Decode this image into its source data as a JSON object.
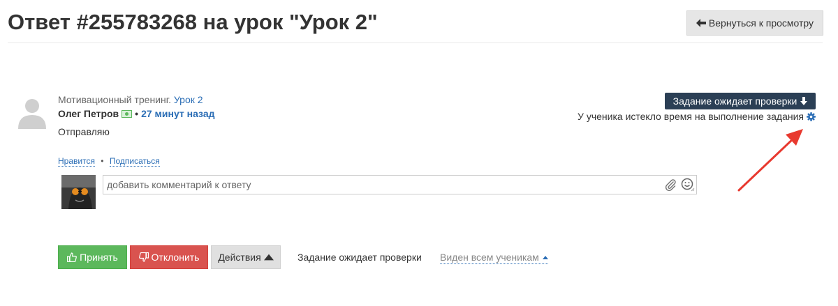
{
  "header": {
    "title": "Ответ #255783268 на урок \"Урок 2\"",
    "back_button_label": "Вернуться к просмотру"
  },
  "answer": {
    "training_prefix": "Мотивационный тренинг.",
    "lesson_link": "Урок 2",
    "author_name": "Олег Петров",
    "separator": "•",
    "time_ago": "27 минут назад",
    "text": "Отправляю",
    "status_badge": "Задание ожидает проверки",
    "expired_notice": "У ученика истекло время на выполнение задания"
  },
  "social": {
    "like_label": "Нравится",
    "separator": "•",
    "subscribe_label": "Подписаться"
  },
  "comment": {
    "placeholder": "добавить комментарий к ответу"
  },
  "toolbar": {
    "accept_label": "Принять",
    "reject_label": "Отклонить",
    "actions_label": "Действия",
    "status_text": "Задание ожидает проверки",
    "visibility_label": "Виден всем ученикам"
  },
  "colors": {
    "accent_blue": "#2a6db5",
    "accept_green": "#5cb85c",
    "reject_red": "#d9534f",
    "badge_dark": "#2b3f55",
    "annotation_arrow": "#e8392f"
  },
  "icons": {
    "back": "arrow-left-icon",
    "badge": "arrow-down-icon",
    "settings": "gear-icon",
    "money": "money-icon",
    "attach": "paperclip-icon",
    "emoji": "smile-icon",
    "accept": "thumbs-up-icon",
    "reject": "thumbs-down-icon"
  }
}
